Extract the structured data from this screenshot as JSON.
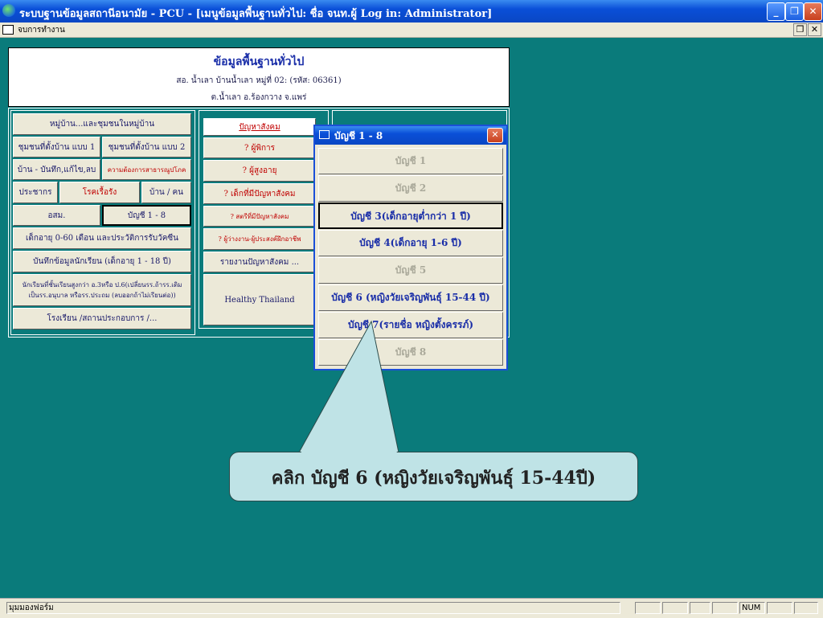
{
  "window": {
    "title": "ระบบฐานข้อมูลสถานีอนามัย - PCU - [เมนูข้อมูลพื้นฐานทั่วไป: ชื่อ จนท.ผู้ Log in: Administrator]",
    "minimize": "_",
    "restore": "❐",
    "close": "✕"
  },
  "menubar": {
    "item": "จบการทำงาน",
    "restore": "❐",
    "close": "✕"
  },
  "header": {
    "title": "ข้อมูลพื้นฐานทั่วไป",
    "line2": "สอ. น้ำเลา บ้านน้ำเลา หมู่ที่ 02: (รหัส: 06361)",
    "line3": "ต.น้ำเลา อ.ร้องกวาง จ.แพร่"
  },
  "left_buttons": {
    "village": "หมู่บ้าน...และชุมชนในหมู่บ้าน",
    "community1": "ชุมชนที่ตั้งบ้าน แบบ 1",
    "community2": "ชุมชนที่ตั้งบ้าน แบบ 2",
    "house": "บ้าน - บันทึก,แก้ไข,ลบ",
    "sanitation": "ความต้องการสาธารณูปโภค",
    "population": "ประชากร",
    "chronic": "โรคเรื้อรัง",
    "house_person": "บ้าน / คน",
    "osm": "อสม.",
    "account18": "บัญชี 1 - 8",
    "child060": "เด็กอายุ 0-60 เดือน และประวัติการรับวัคซีน",
    "student": "บันทึกข้อมูลนักเรียน (เด็กอายุ 1 - 18 ปี)",
    "grad_line1": "นักเรียนที่ชั้นเรียนสูงกว่า อ.3หรือ ป.6(เปลี่ยนรร.ถ้ารร.เดิม",
    "grad_line2": "เป็นรร.อนุบาล หรือรร.ประถม (ลบออกถ้าไม่เรียนต่อ))",
    "school": "โรงเรียน /สถานประกอบการ /..."
  },
  "mid_buttons": {
    "social": "ปัญหาสังคม",
    "disabled": "? ผู้พิการ",
    "elderly": "? ผู้สูงอายุ",
    "child_social": "? เด็กที่มีปัญหาสังคม",
    "women_social": "? สตรีที่มีปัญหาสังคม",
    "unemployed": "? ผู้ว่างงาน-ผู้ประสงค์ฝึกอาชีพ",
    "report": "รายงานปัญหาสังคม ...",
    "healthy": "Healthy Thailand"
  },
  "dialog": {
    "title": "บัญชี 1 - 8",
    "close": "✕",
    "items": [
      "บัญชี 1",
      "บัญชี 2",
      "บัญชี 3(เด็กอายุต่ำกว่า 1 ปี)",
      "บัญชี 4(เด็กอายุ 1-6 ปี)",
      "บัญชี 5",
      "บัญชี 6 (หญิงวัยเจริญพันธุ์ 15-44 ปี)",
      "บัญชี 7(รายชื่อ หญิงตั้งครรภ์)",
      "บัญชี 8"
    ]
  },
  "callout": {
    "text": "คลิก บัญชี 6 (หญิงวัยเจริญพันธุ์ 15-44ปี)"
  },
  "statusbar": {
    "text": "มุมมองฟอร์ม",
    "num": "NUM"
  }
}
